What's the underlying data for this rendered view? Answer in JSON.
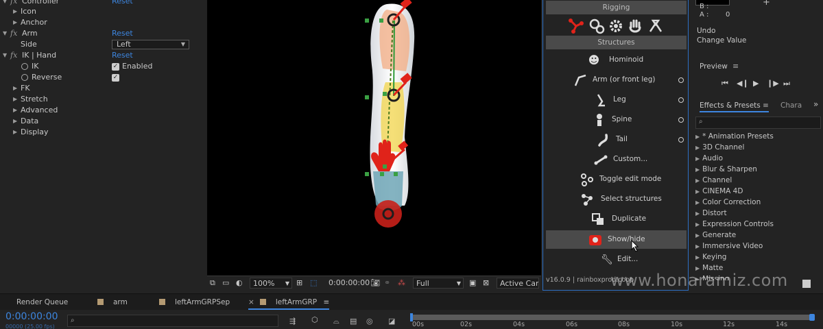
{
  "effect_controls": {
    "rows": [
      {
        "label": "Controller",
        "reset": "Reset"
      },
      {
        "label": "Icon"
      },
      {
        "label": "Anchor"
      },
      {
        "label": "Arm",
        "reset": "Reset"
      },
      {
        "label": "Side",
        "value": "Left"
      },
      {
        "label": "IK | Hand",
        "reset": "Reset"
      },
      {
        "label": "IK",
        "checkbox": "Enabled"
      },
      {
        "label": "Reverse"
      },
      {
        "label": "FK"
      },
      {
        "label": "Stretch"
      },
      {
        "label": "Advanced"
      },
      {
        "label": "Data"
      },
      {
        "label": "Display"
      }
    ]
  },
  "viewer": {
    "zoom": "100%",
    "timecode": "0:00:00:00",
    "resolution": "Full",
    "camera": "Active Camera"
  },
  "rigging": {
    "title": "Rigging",
    "structures_title": "Structures",
    "buttons": [
      {
        "label": "Hominoid",
        "icon": "hominoid-icon"
      },
      {
        "label": "Arm (or front leg)",
        "icon": "arm-icon",
        "dot": true
      },
      {
        "label": "Leg",
        "icon": "leg-icon",
        "dot": true
      },
      {
        "label": "Spine",
        "icon": "spine-icon",
        "dot": true
      },
      {
        "label": "Tail",
        "icon": "tail-icon",
        "dot": true
      },
      {
        "label": "Custom...",
        "icon": "bone-icon"
      },
      {
        "label": "Toggle edit mode",
        "icon": "edit-mode-icon"
      },
      {
        "label": "Select structures",
        "icon": "select-structures-icon"
      },
      {
        "label": "Duplicate",
        "icon": "duplicate-icon"
      },
      {
        "label": "Show/hide",
        "icon": "show-hide-icon",
        "active": true
      },
      {
        "label": "Edit...",
        "icon": "wrench-icon"
      }
    ],
    "version": "v16.0.9 | rainboxprod.coop"
  },
  "info": {
    "b_label": "B :",
    "a_label": "A :",
    "a_value": "0",
    "undo": "Undo",
    "change_value": "Change Value"
  },
  "preview": {
    "title": "Preview"
  },
  "effects": {
    "tab_active": "Effects & Presets",
    "tab_other": "Chara",
    "items": [
      "* Animation Presets",
      "3D Channel",
      "Audio",
      "Blur & Sharpen",
      "Channel",
      "CINEMA 4D",
      "Color Correction",
      "Distort",
      "Expression Controls",
      "Generate",
      "Immersive Video",
      "Keying",
      "Matte",
      "Missing"
    ]
  },
  "timeline": {
    "tabs": [
      "Render Queue",
      "arm",
      "leftArmGRPSep",
      "leftArmGRP"
    ],
    "timecode": "0:00:00:00",
    "fps": "00000 (25.00 fps)",
    "ticks": [
      "00s",
      "02s",
      "04s",
      "06s",
      "08s",
      "10s",
      "12s",
      "14s"
    ]
  },
  "watermark": "www.honaramiz.com",
  "colors": {
    "accent_blue": "#2d6fc4",
    "rig_red": "#e0231a",
    "link_blue": "#3d86e0"
  }
}
